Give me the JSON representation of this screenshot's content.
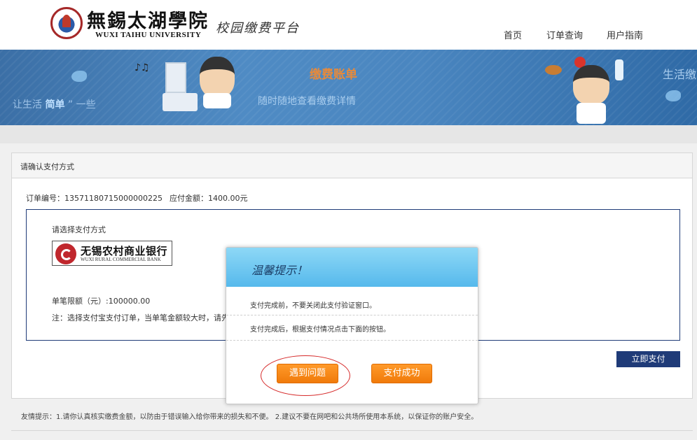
{
  "header": {
    "university_cn": "無錫太湖學院",
    "university_en": "WUXI TAIHU UNIVERSITY",
    "platform": "校园缴费平台",
    "nav": {
      "home": "首页",
      "order_query": "订单查询",
      "user_guide": "用户指南"
    }
  },
  "banner": {
    "slogan_prefix": "让生活",
    "slogan_highlight": "简单",
    "slogan_suffix": "” 一些",
    "title": "缴费账单",
    "subtitle": "随时随地查看缴费详情",
    "right_text": "生活缴"
  },
  "panel": {
    "title": "请确认支付方式",
    "order_no": "订单编号：13571180715000000225",
    "amount": "应付金额：1400.00元",
    "choose_label": "请选择支付方式",
    "bank_cn": "无锡农村商业银行",
    "bank_en": "WUXI RURAL COMMERCIAL BANK",
    "limit": "单笔限额（元）:100000.00",
    "note": "注：选择支付宝支付订单，当单笔金额较大时，请先",
    "pay_now": "立即支付"
  },
  "tips": "友情提示：1.请你认真核实缴费金额，以防由于错误输入给你带来的损失和不便。    2.建议不要在网吧和公共场所使用本系统，以保证你的账户安全。",
  "modal": {
    "title": "温馨提示！",
    "line1": "支付完成前，不要关闭此支付验证窗口。",
    "line2": "支付完成后，根据支付情况点击下面的按钮。",
    "problem_button": "遇到问题",
    "success_button": "支付成功"
  },
  "colors": {
    "banner_blue": "#4a86c0",
    "navy": "#1f3b78",
    "orange_button": "#f07a0a",
    "modal_header": "#56b9ec",
    "highlight_ring": "#d62b2b"
  }
}
